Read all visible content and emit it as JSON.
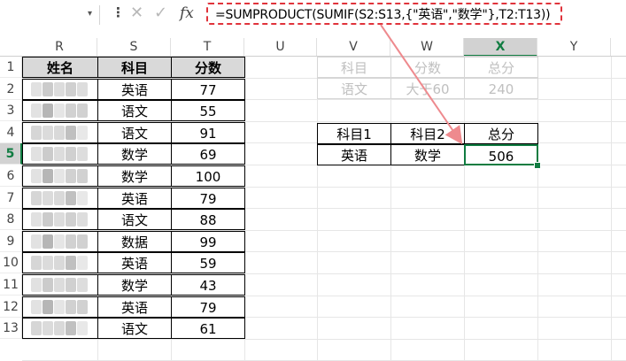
{
  "formula_bar": {
    "name_box": "",
    "more_icon": "more-options-icon",
    "cancel_icon": "cancel-icon",
    "enter_icon": "check-icon",
    "fx_label": "fx",
    "formula": "=SUMPRODUCT(SUMIF(S2:S13,{\"英语\",\"数学\"},T2:T13))"
  },
  "columns": [
    "R",
    "S",
    "T",
    "U",
    "V",
    "W",
    "X",
    "Y"
  ],
  "rows": [
    "1",
    "2",
    "3",
    "4",
    "5",
    "6",
    "7",
    "8",
    "9",
    "10",
    "11",
    "12",
    "13"
  ],
  "table": {
    "headers": [
      "姓名",
      "科目",
      "分数"
    ],
    "subjects": [
      "英语",
      "语文",
      "语文",
      "数学",
      "数学",
      "英语",
      "语文",
      "数据",
      "英语",
      "数学",
      "英语",
      "语文"
    ],
    "scores": [
      "77",
      "55",
      "91",
      "69",
      "100",
      "79",
      "88",
      "99",
      "59",
      "43",
      "79",
      "61"
    ]
  },
  "ghost_table": {
    "headers": [
      "科目",
      "分数",
      "总分"
    ],
    "row": [
      "语文",
      "大于60",
      "240"
    ]
  },
  "summary_table": {
    "headers": [
      "科目1",
      "科目2",
      "总分"
    ],
    "row": [
      "英语",
      "数学",
      "506"
    ]
  },
  "colors": {
    "header_fill": "#d9d9d9",
    "selection": "#107c41",
    "annotation": "#e0333b"
  }
}
